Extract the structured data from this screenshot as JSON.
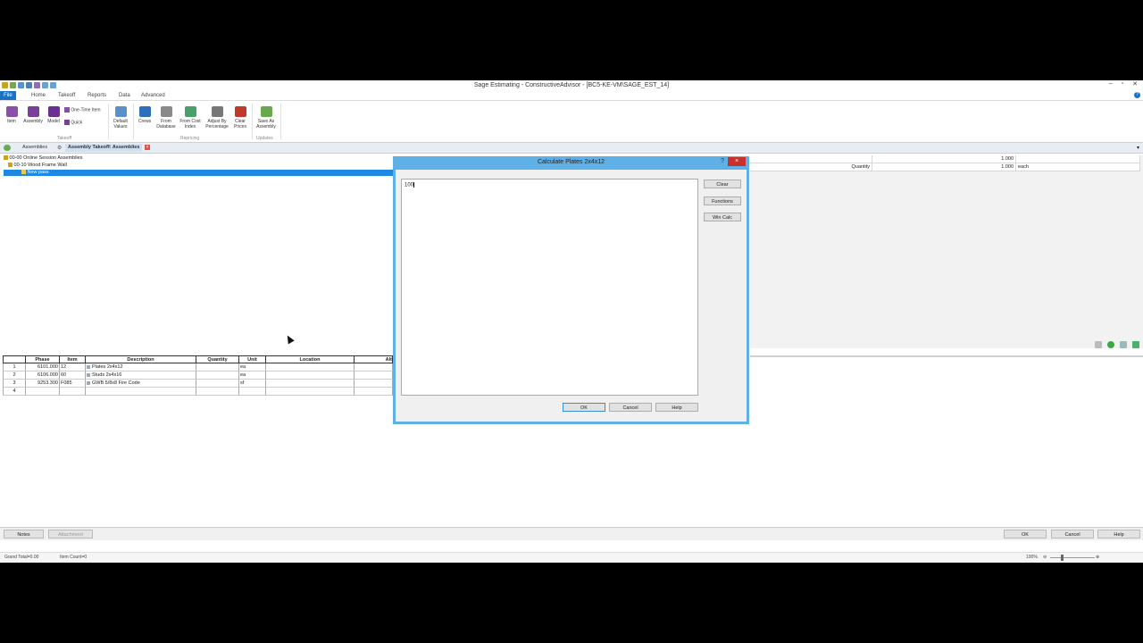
{
  "window": {
    "title": "Sage Estimating - ConstructiveAdvisor - [BC5-KE-VM\\SAGE_EST_14]"
  },
  "menu": {
    "file": "File",
    "home": "Home",
    "takeoff": "Takeoff",
    "reports": "Reports",
    "data": "Data",
    "advanced": "Advanced"
  },
  "ribbon": {
    "item": "Item",
    "assembly": "Assembly",
    "model": "Model",
    "one_time_item": "One-Time Item",
    "quick": "Quick",
    "group_takeoff": "Takeoff",
    "default_values": "Default Values",
    "crews": "Crews",
    "from_database": "From Database",
    "from_cost_index": "From Cost Index",
    "adjust_by_percentage": "Adjust By Percentage",
    "clear_prices": "Clear Prices",
    "group_repricing": "Repricing",
    "save_as_assembly": "Save As Assembly",
    "group_updates": "Updates"
  },
  "doc_tabs": {
    "assemblies": "Assemblies",
    "assembly_takeoff": "Assembly Takeoff: Assemblies"
  },
  "tree": {
    "node1": "00-00  Online Session Assemblies",
    "node2": "00-10  Wood Frame Wall",
    "node3": "New pass"
  },
  "props": {
    "row1_value": "1.000",
    "row2_label": "Quantity",
    "row2_value": "1.000",
    "row2_unit": "each"
  },
  "grid": {
    "headers": {
      "phase": "Phase",
      "item": "Item",
      "description": "Description",
      "quantity": "Quantity",
      "unit": "Unit",
      "location": "Location",
      "alt": "Alt"
    },
    "rows": [
      {
        "num": "1",
        "phase": "6101.000",
        "item": "12",
        "description": "Plates  2x4x12",
        "quantity": "",
        "unit": "ea",
        "location": ""
      },
      {
        "num": "2",
        "phase": "6106.000",
        "item": "60",
        "description": "Studs  2x4x16",
        "quantity": "",
        "unit": "ea",
        "location": ""
      },
      {
        "num": "3",
        "phase": "9253.300",
        "item": "F085",
        "description": "GWB  5/8x8  Fire Code",
        "quantity": "",
        "unit": "sf",
        "location": ""
      },
      {
        "num": "4",
        "phase": "",
        "item": "",
        "description": "",
        "quantity": "",
        "unit": "",
        "location": ""
      }
    ]
  },
  "dialog": {
    "title": "Calculate Plates  2x4x12",
    "help_glyph": "?",
    "close_glyph": "×",
    "value": "100",
    "clear": "Clear",
    "functions": "Functions",
    "win_calc": "Win Calc",
    "ok": "OK",
    "cancel": "Cancel",
    "help": "Help"
  },
  "bottom": {
    "notes": "Notes",
    "attachment": "Attachment",
    "ok": "OK",
    "cancel": "Cancel",
    "help": "Help"
  },
  "status": {
    "grand_total": "Grand Total=0.00",
    "item_count": "Item Count=0",
    "zoom": "100%"
  }
}
